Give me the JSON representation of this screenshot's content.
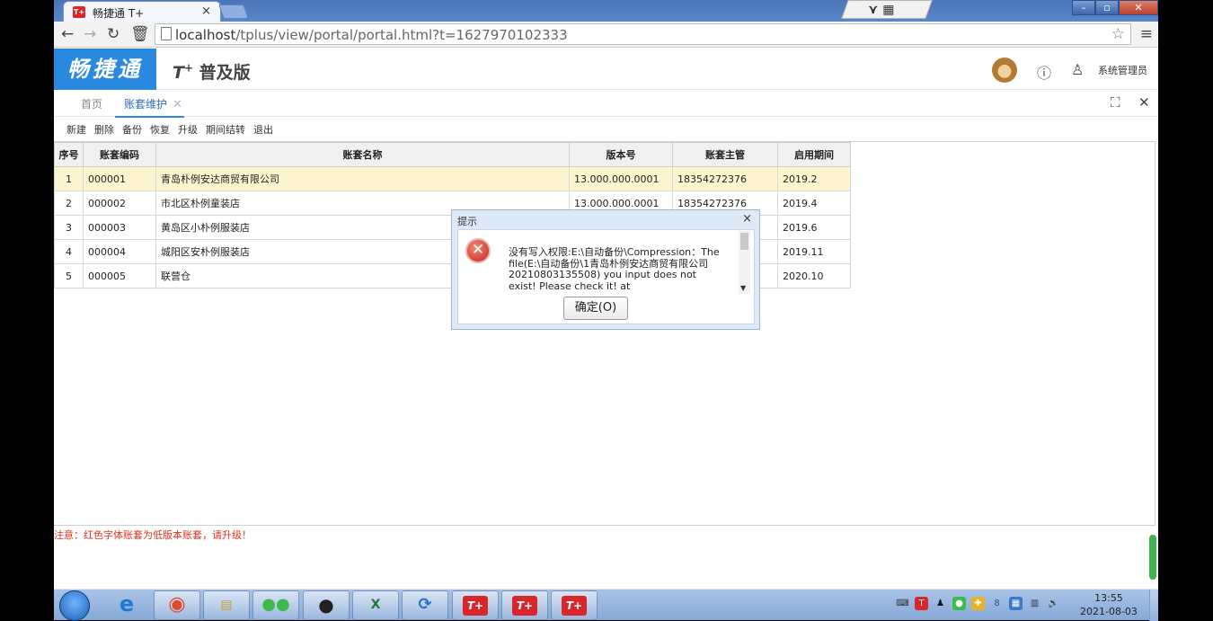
{
  "browser": {
    "tab_title": "畅捷通 T+",
    "tab_close": "×",
    "favicon_text": "T+",
    "url_host": "localhost",
    "url_rest": "/tplus/view/portal/portal.html?t=1627970102333",
    "window_buttons": [
      "–",
      "▫",
      "✕"
    ],
    "icons": [
      "back-icon",
      "forward-icon",
      "reload-icon",
      "trash-icon",
      "page-icon",
      "star-icon",
      "menu-icon"
    ]
  },
  "app": {
    "logo": "畅捷通",
    "product": "T",
    "product_sup": "+",
    "product_name": "普及版",
    "user": "系统管理员",
    "accent": "#2a8ae0"
  },
  "tabs": [
    {
      "label": "首页"
    },
    {
      "label": "账套维护"
    }
  ],
  "actions": [
    "新建",
    "删除",
    "备份",
    "恢复",
    "升级",
    "期间结转",
    "退出"
  ],
  "table": {
    "columns": [
      "序号",
      "账套编码",
      "账套名称",
      "版本号",
      "账套主管",
      "启用期间"
    ],
    "rows": [
      {
        "no": "1",
        "code": "000001",
        "name": "青岛朴例安达商贸有限公司",
        "version": "13.000.000.0001",
        "manager": "18354272376",
        "period": "2019.2"
      },
      {
        "no": "2",
        "code": "000002",
        "name": "市北区朴例童装店",
        "version": "13.000.000.0001",
        "manager": "18354272376",
        "period": "2019.4"
      },
      {
        "no": "3",
        "code": "000003",
        "name": "黄岛区小朴例服装店",
        "version": "",
        "manager": "",
        "period": "2019.6"
      },
      {
        "no": "4",
        "code": "000004",
        "name": "城阳区安朴例服装店",
        "version": "",
        "manager": "",
        "period": "2019.11"
      },
      {
        "no": "5",
        "code": "000005",
        "name": "联营仓",
        "version": "",
        "manager": "",
        "period": "2020.10"
      }
    ]
  },
  "notice": "注意：红色字体账套为低版本账套，请升级！",
  "dialog": {
    "title": "提示",
    "close": "×",
    "message": "没有写入权限:E:\\自动备份\\Compression：The file(E:\\自动备份\\1青岛朴例安达商贸有限公司20210803135508) you input does not exist! Please check it! at",
    "ok": "确定(O)"
  },
  "taskbar": {
    "time": "13:55",
    "date": "2021-08-03"
  }
}
